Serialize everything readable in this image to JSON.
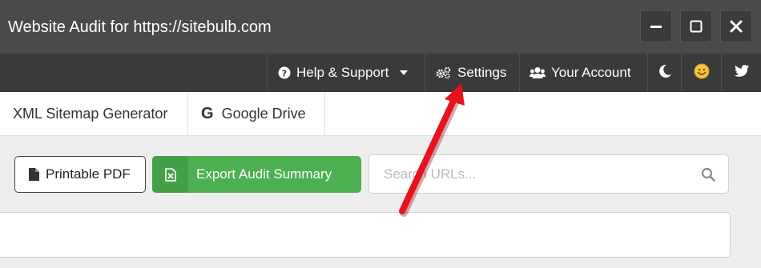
{
  "window": {
    "title": "Website Audit for https://sitebulb.com",
    "controls": {
      "minimize": "minimize-icon",
      "maximize": "maximize-icon",
      "close": "close-icon"
    }
  },
  "menubar": {
    "help_label": "Help & Support",
    "settings_label": "Settings",
    "account_label": "Your Account",
    "icons": [
      "question-circle-icon",
      "gears-icon",
      "users-icon",
      "moon-icon",
      "smiley-icon",
      "twitter-icon"
    ]
  },
  "tabs": [
    {
      "label": "XML Sitemap Generator"
    },
    {
      "label": "Google Drive",
      "icon": "google-g-icon",
      "icon_glyph": "G"
    }
  ],
  "toolbar": {
    "pdf_label": "Printable PDF",
    "export_label": "Export Audit Summary",
    "search_placeholder": "Search URLs..."
  },
  "colors": {
    "titlebar": "#4a4a4a",
    "menubar": "#3a3a3a",
    "export_green": "#4caf50",
    "annotation_red": "#e8121b"
  },
  "annotation": {
    "type": "arrow",
    "target": "Settings"
  }
}
